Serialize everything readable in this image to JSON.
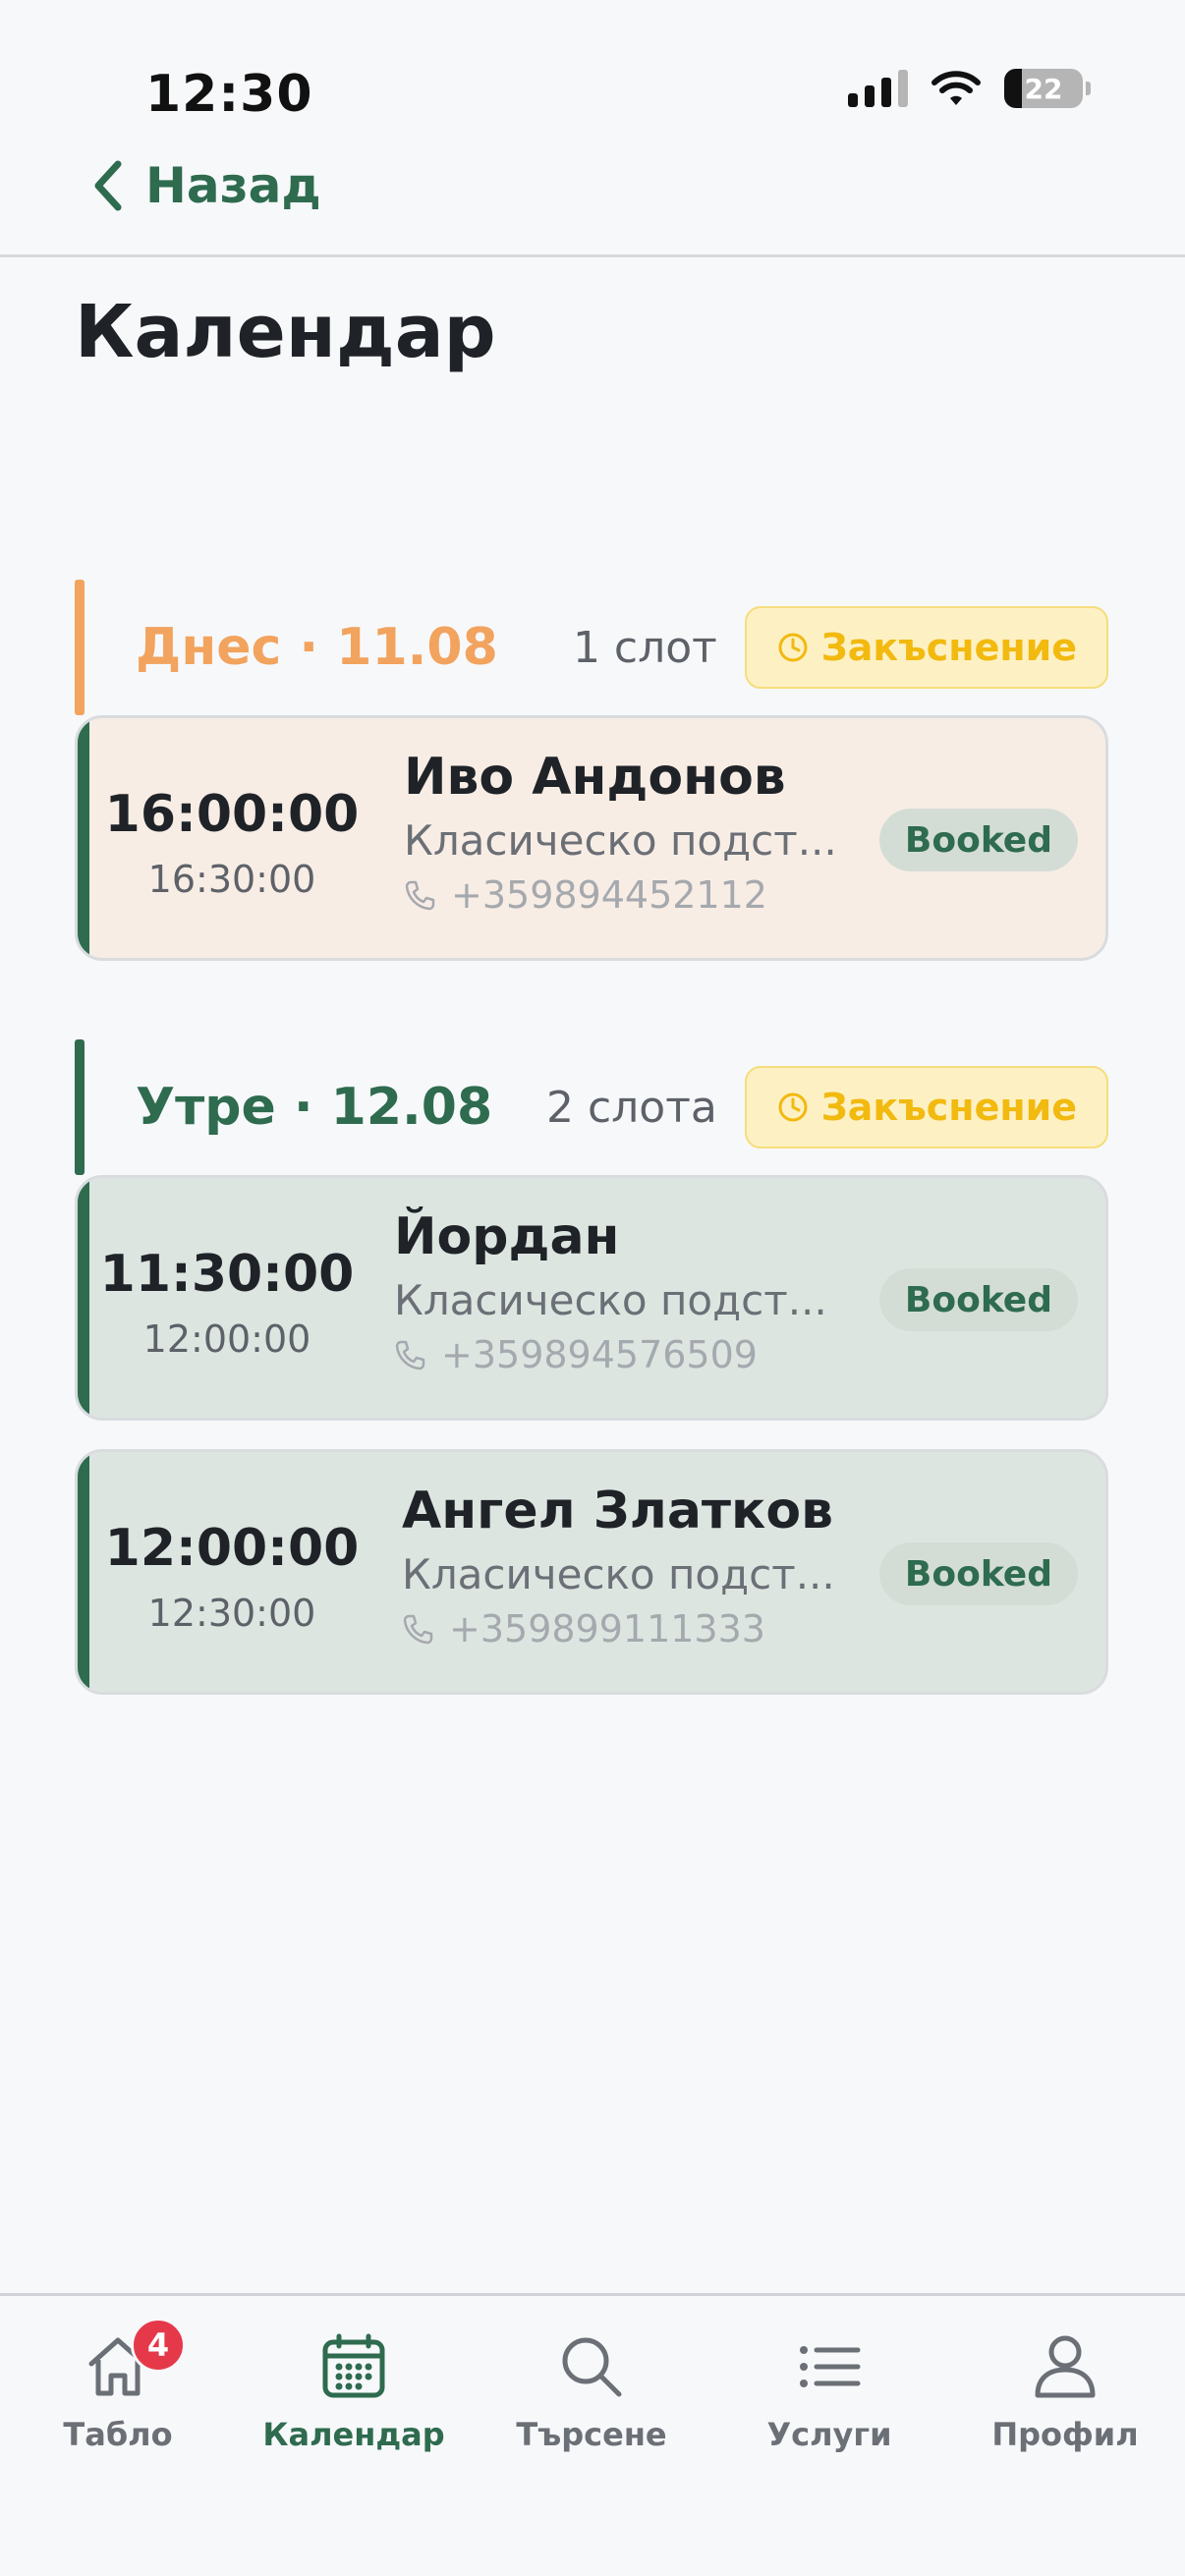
{
  "status_bar": {
    "time": "12:30",
    "battery_level": "22"
  },
  "nav": {
    "back_label": "Назад"
  },
  "page": {
    "title": "Календар"
  },
  "days": [
    {
      "label": "Днес · 11.08",
      "accent_color": "#f2a35e",
      "slot_count": "1 слот",
      "late_label": "Закъснение",
      "bookings": [
        {
          "start": "16:00:00",
          "end": "16:30:00",
          "client": "Иво Андонов",
          "service": "Класическо подст...",
          "phone": "+359894452112",
          "status": "Booked"
        }
      ]
    },
    {
      "label": "Утре · 12.08",
      "accent_color": "#2e6b4f",
      "slot_count": "2 слота",
      "late_label": "Закъснение",
      "bookings": [
        {
          "start": "11:30:00",
          "end": "12:00:00",
          "client": "Йордан",
          "service": "Класическо подст...",
          "phone": "+359894576509",
          "status": "Booked"
        },
        {
          "start": "12:00:00",
          "end": "12:30:00",
          "client": "Ангел Златков",
          "service": "Класическо подст...",
          "phone": "+359899111333",
          "status": "Booked"
        }
      ]
    }
  ],
  "colors": {
    "brand_green": "#2e6b4f",
    "today_accent": "#f2a35e",
    "today_card_bg": "#f8ede5",
    "tomorrow_card_bg": "#dde5e1",
    "late_badge_text": "#f2b90f",
    "notification_red": "#e5394a"
  },
  "tab_bar": {
    "items": [
      {
        "label": "Табло",
        "icon": "home-icon",
        "badge": "4"
      },
      {
        "label": "Календар",
        "icon": "calendar-icon",
        "active": true
      },
      {
        "label": "Търсене",
        "icon": "search-icon"
      },
      {
        "label": "Услуги",
        "icon": "list-icon"
      },
      {
        "label": "Профил",
        "icon": "profile-icon"
      }
    ]
  }
}
